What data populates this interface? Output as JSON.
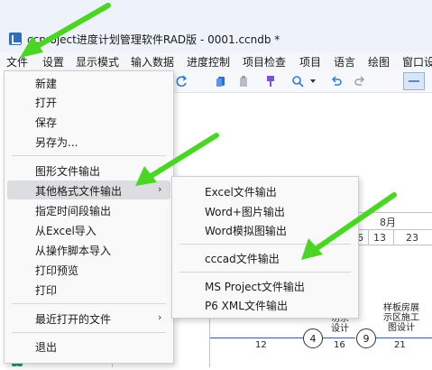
{
  "window": {
    "title": "ccproject进度计划管理软件RAD版 - 0001.ccndb *"
  },
  "menubar": [
    "文件",
    "设置",
    "显示模式",
    "输入数据",
    "进度控制",
    "项目检查",
    "项目",
    "语言",
    "绘图",
    "窗口设"
  ],
  "file_menu": {
    "items": [
      {
        "label": "新建"
      },
      {
        "label": "打开"
      },
      {
        "label": "保存"
      },
      {
        "label": "另存为..."
      },
      {
        "label": "图形文件输出",
        "submenu": true
      },
      {
        "label": "其他格式文件输出",
        "submenu": true,
        "highlighted": true
      },
      {
        "label": "指定时间段输出"
      },
      {
        "label": "从Excel导入"
      },
      {
        "label": "从操作脚本导入"
      },
      {
        "label": "打印预览"
      },
      {
        "label": "打印"
      },
      {
        "label": "最近打开的文件",
        "submenu": true
      },
      {
        "label": "退出"
      }
    ]
  },
  "submenu": {
    "items": [
      {
        "label": "Excel文件输出"
      },
      {
        "label": "Word+图片输出"
      },
      {
        "label": "Word模拟图输出"
      },
      {
        "label": "cccad文件输出"
      },
      {
        "label": "MS Project文件输出"
      },
      {
        "label": "P6 XML文件输出"
      }
    ]
  },
  "gantt": {
    "month": "8月",
    "days": [
      "30",
      "6",
      "13",
      "23"
    ],
    "nodes": [
      "4",
      "9"
    ],
    "durations": [
      "12",
      "16",
      "21"
    ],
    "tasks": [
      "设计",
      "样板房展\n示区施工\n图设计",
      "勿杀\n设计"
    ]
  },
  "colors": {
    "accent": "#2b5fa8",
    "arrow": "#4cd624",
    "highlight": "#dcdde1"
  },
  "icons": [
    "app-icon",
    "redo-icon",
    "copy-icon",
    "paste-icon",
    "format-icon",
    "search-icon",
    "undo-icon",
    "redo-arrow-icon",
    "minimize-icon",
    "people-icon"
  ]
}
